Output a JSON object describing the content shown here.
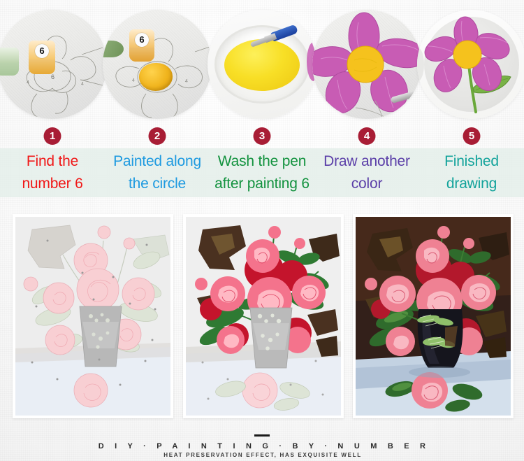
{
  "background": {
    "paper_color": "#fafafa",
    "band_color": "#e4eeea"
  },
  "steps": {
    "badge_color": "#a81d35",
    "items": [
      {
        "number": "1",
        "badge_label": "1",
        "caption_line1": "Find the",
        "caption_line2": "number 6",
        "caption_color": "#f01818",
        "image_name": "paint-pots-on-numbered-canvas",
        "paint_pot_number": "6",
        "canvas_numbers": [
          "4",
          "6",
          "4"
        ]
      },
      {
        "number": "2",
        "badge_label": "2",
        "caption_line1": "Painted along",
        "caption_line2": "the circle",
        "caption_color": "#1e9ae0",
        "image_name": "yellow-circle-painted-on-canvas",
        "paint_pot_number": "6",
        "canvas_numbers": [
          "4",
          "4"
        ],
        "paint_color": "#f2bb23"
      },
      {
        "number": "3",
        "badge_label": "3",
        "caption_line1": "Wash the pen",
        "caption_line2": "after painting 6",
        "caption_color": "#12923e",
        "image_name": "brush-washing-in-glass-bowl",
        "water_color": "#f6df2a",
        "brush_handle_color": "#1f47a8"
      },
      {
        "number": "4",
        "badge_label": "4",
        "caption_line1": "Draw another",
        "caption_line2": "color",
        "caption_color": "#5b3fa8",
        "image_name": "pink-flower-petals-painted",
        "petal_color": "#c85cb4",
        "center_color": "#f5c21d"
      },
      {
        "number": "5",
        "badge_label": "5",
        "caption_line1": "Finished",
        "caption_line2": "drawing",
        "caption_color": "#13a39b",
        "image_name": "finished-flower-with-stem-and-leaf",
        "petal_color": "#c85cb4",
        "center_color": "#f5c21d",
        "stem_color": "#6aa83a"
      }
    ]
  },
  "artwork": {
    "subject": "pink roses in a vase still life",
    "panels": [
      {
        "name": "blank-numbered-canvas",
        "stage_label": "outline only",
        "background_color": "#ececec",
        "rose_color": "#f6c9cd",
        "leaf_color": "#d8e0d0",
        "vase_color": "#b5b5b5",
        "table_color": "#e8ecf2"
      },
      {
        "name": "partially-painted-canvas",
        "stage_label": "partly painted",
        "background_color": "#efefef",
        "rose_color": "#f4738c",
        "rose_deep_color": "#c4142c",
        "leaf_color": "#2f7a33",
        "leaf_dark_color": "#4a3120",
        "vase_color": "#b9b9b9",
        "table_color": "#e9edf4"
      },
      {
        "name": "finished-painting",
        "stage_label": "finished",
        "background_color": "#3b2319",
        "rose_color": "#ef8193",
        "rose_deep_color": "#c4142c",
        "leaf_color": "#2f6b2c",
        "leaf_dark_color": "#5b4024",
        "vase_color": "#17171f",
        "table_color": "#c3d2e2"
      }
    ]
  },
  "footer": {
    "divider": "—",
    "title": "D I Y · P A I N T I N G · B Y · N U M B E R",
    "subtitle": "HEAT PRESERVATION EFFECT, HAS EXQUISITE WELL"
  }
}
